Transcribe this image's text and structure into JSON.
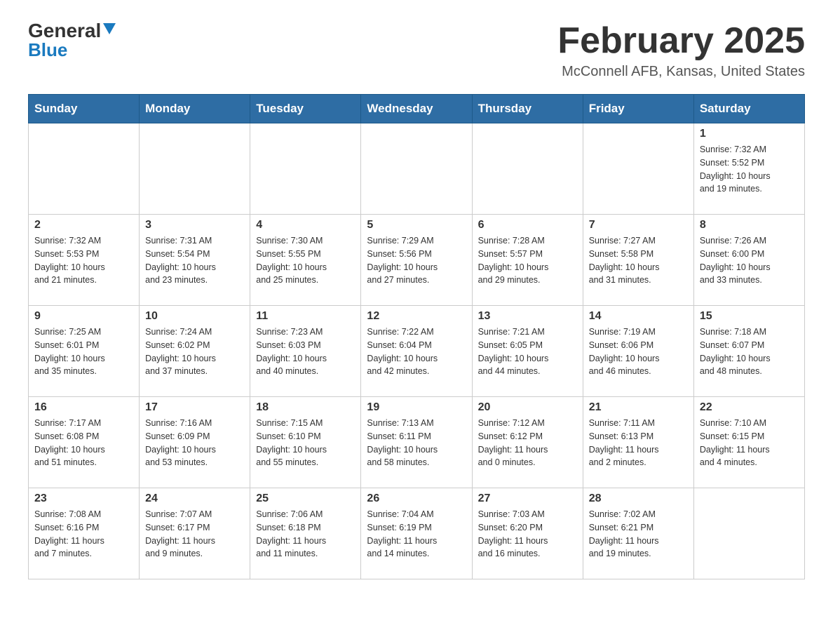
{
  "header": {
    "logo_general": "General",
    "logo_blue": "Blue",
    "month_title": "February 2025",
    "location": "McConnell AFB, Kansas, United States"
  },
  "weekdays": [
    "Sunday",
    "Monday",
    "Tuesday",
    "Wednesday",
    "Thursday",
    "Friday",
    "Saturday"
  ],
  "weeks": [
    [
      {
        "day": "",
        "info": ""
      },
      {
        "day": "",
        "info": ""
      },
      {
        "day": "",
        "info": ""
      },
      {
        "day": "",
        "info": ""
      },
      {
        "day": "",
        "info": ""
      },
      {
        "day": "",
        "info": ""
      },
      {
        "day": "1",
        "info": "Sunrise: 7:32 AM\nSunset: 5:52 PM\nDaylight: 10 hours\nand 19 minutes."
      }
    ],
    [
      {
        "day": "2",
        "info": "Sunrise: 7:32 AM\nSunset: 5:53 PM\nDaylight: 10 hours\nand 21 minutes."
      },
      {
        "day": "3",
        "info": "Sunrise: 7:31 AM\nSunset: 5:54 PM\nDaylight: 10 hours\nand 23 minutes."
      },
      {
        "day": "4",
        "info": "Sunrise: 7:30 AM\nSunset: 5:55 PM\nDaylight: 10 hours\nand 25 minutes."
      },
      {
        "day": "5",
        "info": "Sunrise: 7:29 AM\nSunset: 5:56 PM\nDaylight: 10 hours\nand 27 minutes."
      },
      {
        "day": "6",
        "info": "Sunrise: 7:28 AM\nSunset: 5:57 PM\nDaylight: 10 hours\nand 29 minutes."
      },
      {
        "day": "7",
        "info": "Sunrise: 7:27 AM\nSunset: 5:58 PM\nDaylight: 10 hours\nand 31 minutes."
      },
      {
        "day": "8",
        "info": "Sunrise: 7:26 AM\nSunset: 6:00 PM\nDaylight: 10 hours\nand 33 minutes."
      }
    ],
    [
      {
        "day": "9",
        "info": "Sunrise: 7:25 AM\nSunset: 6:01 PM\nDaylight: 10 hours\nand 35 minutes."
      },
      {
        "day": "10",
        "info": "Sunrise: 7:24 AM\nSunset: 6:02 PM\nDaylight: 10 hours\nand 37 minutes."
      },
      {
        "day": "11",
        "info": "Sunrise: 7:23 AM\nSunset: 6:03 PM\nDaylight: 10 hours\nand 40 minutes."
      },
      {
        "day": "12",
        "info": "Sunrise: 7:22 AM\nSunset: 6:04 PM\nDaylight: 10 hours\nand 42 minutes."
      },
      {
        "day": "13",
        "info": "Sunrise: 7:21 AM\nSunset: 6:05 PM\nDaylight: 10 hours\nand 44 minutes."
      },
      {
        "day": "14",
        "info": "Sunrise: 7:19 AM\nSunset: 6:06 PM\nDaylight: 10 hours\nand 46 minutes."
      },
      {
        "day": "15",
        "info": "Sunrise: 7:18 AM\nSunset: 6:07 PM\nDaylight: 10 hours\nand 48 minutes."
      }
    ],
    [
      {
        "day": "16",
        "info": "Sunrise: 7:17 AM\nSunset: 6:08 PM\nDaylight: 10 hours\nand 51 minutes."
      },
      {
        "day": "17",
        "info": "Sunrise: 7:16 AM\nSunset: 6:09 PM\nDaylight: 10 hours\nand 53 minutes."
      },
      {
        "day": "18",
        "info": "Sunrise: 7:15 AM\nSunset: 6:10 PM\nDaylight: 10 hours\nand 55 minutes."
      },
      {
        "day": "19",
        "info": "Sunrise: 7:13 AM\nSunset: 6:11 PM\nDaylight: 10 hours\nand 58 minutes."
      },
      {
        "day": "20",
        "info": "Sunrise: 7:12 AM\nSunset: 6:12 PM\nDaylight: 11 hours\nand 0 minutes."
      },
      {
        "day": "21",
        "info": "Sunrise: 7:11 AM\nSunset: 6:13 PM\nDaylight: 11 hours\nand 2 minutes."
      },
      {
        "day": "22",
        "info": "Sunrise: 7:10 AM\nSunset: 6:15 PM\nDaylight: 11 hours\nand 4 minutes."
      }
    ],
    [
      {
        "day": "23",
        "info": "Sunrise: 7:08 AM\nSunset: 6:16 PM\nDaylight: 11 hours\nand 7 minutes."
      },
      {
        "day": "24",
        "info": "Sunrise: 7:07 AM\nSunset: 6:17 PM\nDaylight: 11 hours\nand 9 minutes."
      },
      {
        "day": "25",
        "info": "Sunrise: 7:06 AM\nSunset: 6:18 PM\nDaylight: 11 hours\nand 11 minutes."
      },
      {
        "day": "26",
        "info": "Sunrise: 7:04 AM\nSunset: 6:19 PM\nDaylight: 11 hours\nand 14 minutes."
      },
      {
        "day": "27",
        "info": "Sunrise: 7:03 AM\nSunset: 6:20 PM\nDaylight: 11 hours\nand 16 minutes."
      },
      {
        "day": "28",
        "info": "Sunrise: 7:02 AM\nSunset: 6:21 PM\nDaylight: 11 hours\nand 19 minutes."
      },
      {
        "day": "",
        "info": ""
      }
    ]
  ]
}
